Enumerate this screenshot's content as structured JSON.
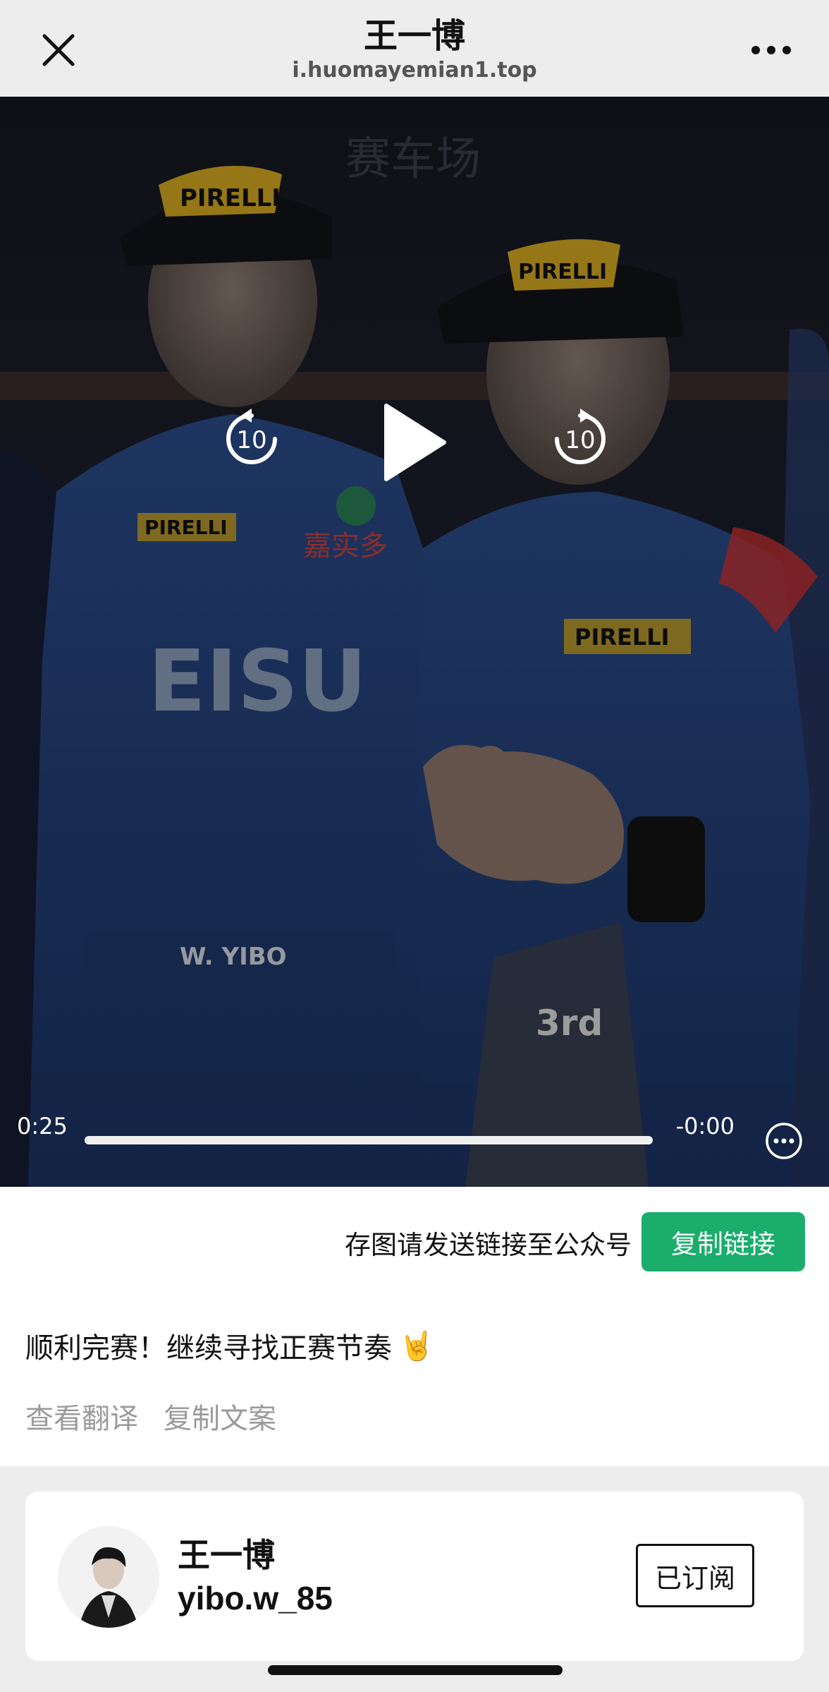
{
  "topbar": {
    "title": "王一博",
    "url": "i.huomayemian1.top"
  },
  "video": {
    "time_current": "0:25",
    "time_remaining": "-0:00",
    "progress": 1.0,
    "rewind_seconds": "10",
    "forward_seconds": "10",
    "icons": [
      "close-icon",
      "more-icon",
      "rewind-10-icon",
      "play-icon",
      "forward-10-icon",
      "more-options-icon"
    ]
  },
  "actions": {
    "save_hint": "存图请发送链接至公众号",
    "copy_link": "复制链接",
    "accent_color": "#1aad6c"
  },
  "post": {
    "caption": "顺利完赛！继续寻找正赛节奏",
    "caption_emoji": "🤘",
    "translate_link": "查看翻译",
    "copy_text_link": "复制文案"
  },
  "author": {
    "name": "王一博",
    "handle": "yibo.w_85",
    "subscribe_label": "已订阅"
  }
}
